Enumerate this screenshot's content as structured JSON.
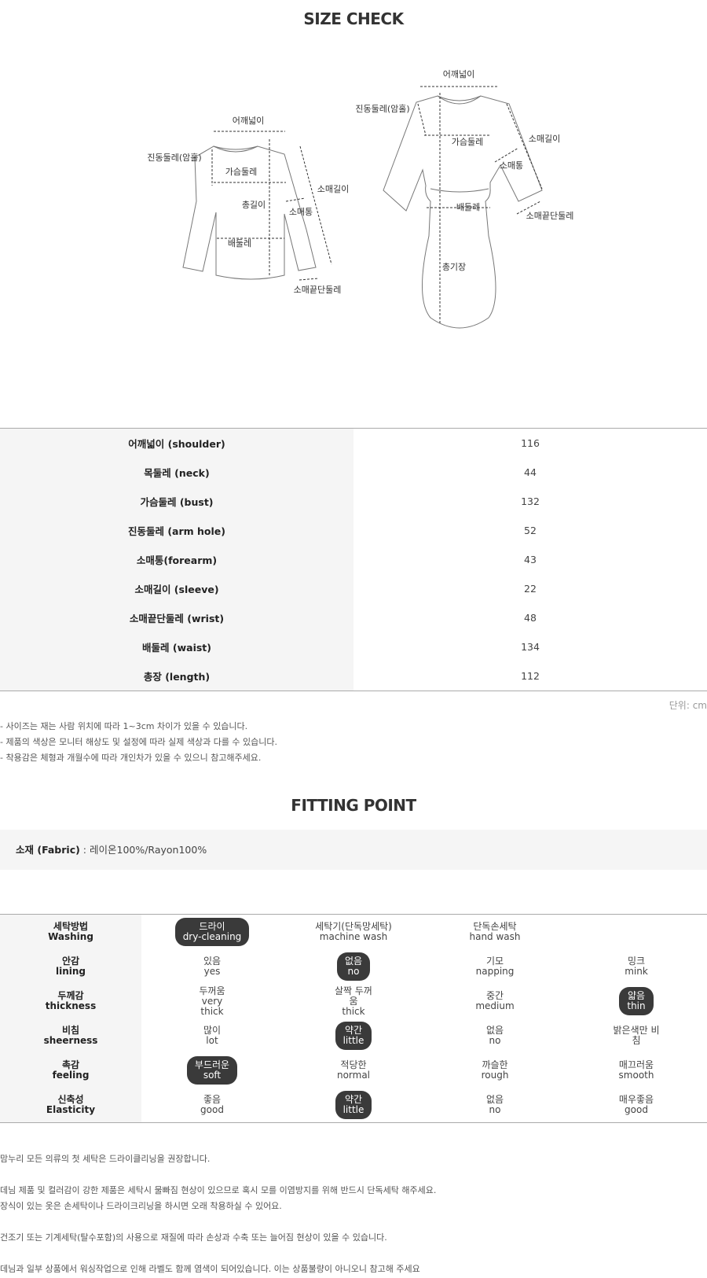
{
  "size_check": {
    "title": "SIZE CHECK",
    "diagram": {
      "top_labels": {
        "shoulder": "어깨넓이",
        "armhole": "진동둘레(암홀)",
        "bust": "가슴둘레",
        "length": "총길이",
        "forearm": "소매통",
        "sleeve": "소매길이",
        "waist": "배둘레",
        "wrist": "소매끝단둘레"
      },
      "dress_labels": {
        "shoulder": "어깨넓이",
        "armhole": "진동둘레(암홀)",
        "bust": "가슴둘레",
        "sleeve": "소매길이",
        "forearm": "소매통",
        "waist": "배둘레",
        "wrist": "소매끝단둘레",
        "length": "총기장"
      }
    },
    "rows": [
      {
        "label": "어깨넓이 (shoulder)",
        "value": "116"
      },
      {
        "label": "목둘레 (neck)",
        "value": "44"
      },
      {
        "label": "가슴둘레 (bust)",
        "value": "132"
      },
      {
        "label": "진동둘레 (arm hole)",
        "value": "52"
      },
      {
        "label": "소매통(forearm)",
        "value": "43"
      },
      {
        "label": "소매길이 (sleeve)",
        "value": "22"
      },
      {
        "label": "소매끝단둘레 (wrist)",
        "value": "48"
      },
      {
        "label": "배둘레 (waist)",
        "value": "134"
      },
      {
        "label": "총장 (length)",
        "value": "112"
      }
    ],
    "unit": "단위: cm",
    "notes": [
      "- 사이즈는 재는 사람 위치에 따라 1~3cm 차이가 있을 수 있습니다.",
      "- 제품의 색상은 모니터 해상도 및 설정에 따라 실제 색상과 다를 수 있습니다.",
      "- 착용감은 체형과 개월수에 따라 개인차가 있을 수 있으니 참고해주세요."
    ]
  },
  "fitting_point": {
    "title": "FITTING POINT",
    "fabric_label": "소재 (Fabric)",
    "fabric_value": " : 레이온100%/Rayon100%",
    "rows": [
      {
        "ko": "세탁방법",
        "en": "Washing",
        "options": [
          {
            "ko": "드라이",
            "en": "dry-cleaning",
            "selected": true
          },
          {
            "ko": "세탁기(단독망세탁)",
            "en": "machine wash",
            "selected": false
          },
          {
            "ko": "단독손세탁",
            "en": "hand wash",
            "selected": false
          },
          {
            "ko": "",
            "en": "",
            "selected": false
          }
        ]
      },
      {
        "ko": "안감",
        "en": "lining",
        "options": [
          {
            "ko": "있음",
            "en": "yes",
            "selected": false
          },
          {
            "ko": "없음",
            "en": "no",
            "selected": true
          },
          {
            "ko": "기모",
            "en": "napping",
            "selected": false
          },
          {
            "ko": "밍크",
            "en": "mink",
            "selected": false
          }
        ]
      },
      {
        "ko": "두께감",
        "en": "thickness",
        "options": [
          {
            "ko": "두꺼움",
            "en": "very\nthick",
            "selected": false
          },
          {
            "ko": "살짝 두꺼\n움",
            "en": "thick",
            "selected": false
          },
          {
            "ko": "중간",
            "en": "medium",
            "selected": false
          },
          {
            "ko": "얇음",
            "en": "thin",
            "selected": true
          }
        ]
      },
      {
        "ko": "비침",
        "en": "sheerness",
        "options": [
          {
            "ko": "많이",
            "en": "lot",
            "selected": false
          },
          {
            "ko": "약간",
            "en": "little",
            "selected": true
          },
          {
            "ko": "없음",
            "en": "no",
            "selected": false
          },
          {
            "ko": "밝은색만 비\n침",
            "en": "",
            "selected": false
          }
        ]
      },
      {
        "ko": "촉감",
        "en": "feeling",
        "options": [
          {
            "ko": "부드러운",
            "en": "soft",
            "selected": true
          },
          {
            "ko": "적당한",
            "en": "normal",
            "selected": false
          },
          {
            "ko": "까슬한",
            "en": "rough",
            "selected": false
          },
          {
            "ko": "매끄러움",
            "en": "smooth",
            "selected": false
          }
        ]
      },
      {
        "ko": "신축성",
        "en": "Elasticity",
        "options": [
          {
            "ko": "좋음",
            "en": "good",
            "selected": false
          },
          {
            "ko": "약간",
            "en": "little",
            "selected": true
          },
          {
            "ko": "없음",
            "en": "no",
            "selected": false
          },
          {
            "ko": "매우좋음",
            "en": "good",
            "selected": false
          }
        ]
      }
    ],
    "care_notes": [
      "맘누리 모든 의류의 첫 세탁은 드라이클리닝을 권장합니다.",
      "",
      "데님 제품 및 컬러감이 강한 제품은 세탁시 물빠짐 현상이 있으므로 혹시 모를 이염방지를 위해 반드시 단독세탁 해주세요.",
      "장식이 있는 옷은 손세탁이나 드라이크리닝을 하시면 오래 착용하실 수 있어요.",
      "",
      "건조기 또는 기계세탁(탈수포함)의 사용으로 재질에 따라 손상과 수축 또는 늘어짐 현상이 있을 수 있습니다.",
      "",
      "데님과 일부 상품에서 워싱작업으로 인해 라벨도 함께 염색이 되어있습니다. 이는 상품불량이 아니오니 참고해 주세요"
    ]
  }
}
